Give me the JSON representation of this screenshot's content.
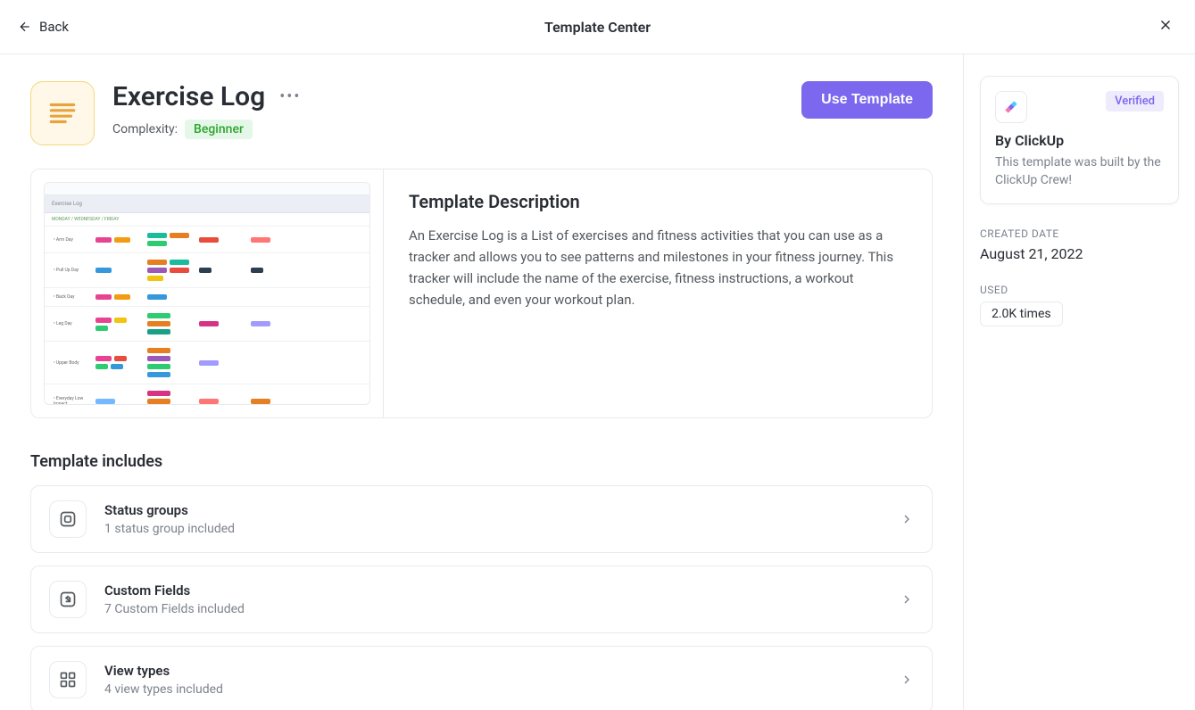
{
  "header": {
    "back_label": "Back",
    "title": "Template Center"
  },
  "template": {
    "title": "Exercise Log",
    "complexity_label": "Complexity:",
    "complexity_value": "Beginner",
    "use_button": "Use Template"
  },
  "description": {
    "heading": "Template Description",
    "body": "An Exercise Log is a List of exercises and fitness activities that you can use as a tracker and allows you to see patterns and milestones in your fitness journey. This tracker will include the name of the exercise, fitness instructions, a workout schedule, and even your workout plan."
  },
  "includes": {
    "heading": "Template includes",
    "items": [
      {
        "title": "Status groups",
        "subtitle": "1 status group included"
      },
      {
        "title": "Custom Fields",
        "subtitle": "7 Custom Fields included"
      },
      {
        "title": "View types",
        "subtitle": "4 view types included"
      }
    ]
  },
  "sidebar": {
    "verified_label": "Verified",
    "by_label": "By ClickUp",
    "by_desc": "This template was built by the ClickUp Crew!",
    "created_label": "CREATED DATE",
    "created_value": "August 21, 2022",
    "used_label": "USED",
    "used_value": "2.0K times"
  }
}
